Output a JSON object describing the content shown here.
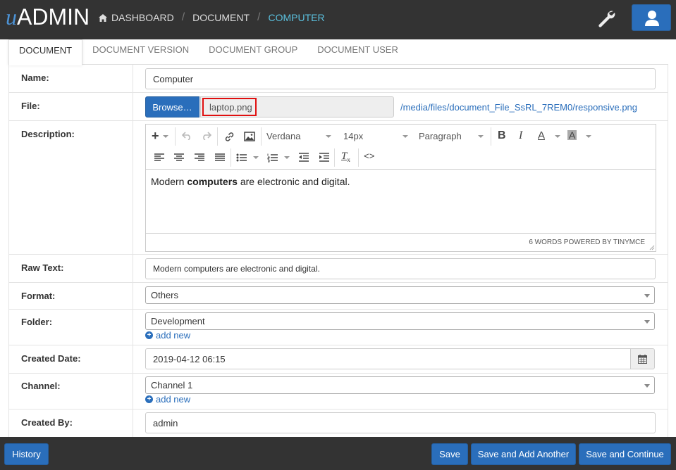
{
  "header": {
    "logo_prefix": "u",
    "logo_text": "ADMIN",
    "breadcrumbs": [
      "DASHBOARD",
      "DOCUMENT",
      "COMPUTER"
    ]
  },
  "tabs": [
    "DOCUMENT",
    "DOCUMENT VERSION",
    "DOCUMENT GROUP",
    "DOCUMENT USER"
  ],
  "form": {
    "name": {
      "label": "Name:",
      "value": "Computer"
    },
    "file": {
      "label": "File:",
      "browse": "Browse…",
      "filename": "laptop.png",
      "link": "/media/files/document_File_SsRL_7REM0/responsive.png"
    },
    "description": {
      "label": "Description:",
      "font": "Verdana",
      "size": "14px",
      "block": "Paragraph",
      "text_before": "Modern ",
      "text_bold": "computers",
      "text_after": " are electronic and digital.",
      "status": "6 WORDS POWERED BY TINYMCE"
    },
    "raw_text": {
      "label": "Raw Text:",
      "value": "Modern computers are electronic and digital."
    },
    "format": {
      "label": "Format:",
      "value": "Others"
    },
    "folder": {
      "label": "Folder:",
      "value": "Development",
      "add_new": "add new"
    },
    "created_date": {
      "label": "Created Date:",
      "value": "2019-04-12 06:15"
    },
    "channel": {
      "label": "Channel:",
      "value": "Channel 1",
      "add_new": "add new"
    },
    "created_by": {
      "label": "Created By:",
      "value": "admin"
    }
  },
  "footer": {
    "history": "History",
    "save": "Save",
    "save_add": "Save and Add Another",
    "save_continue": "Save and Continue"
  },
  "colors": {
    "primary": "#2a6ebb",
    "navbar": "#333333",
    "active_crumb": "#5bc0de",
    "highlight": "#e01010"
  }
}
